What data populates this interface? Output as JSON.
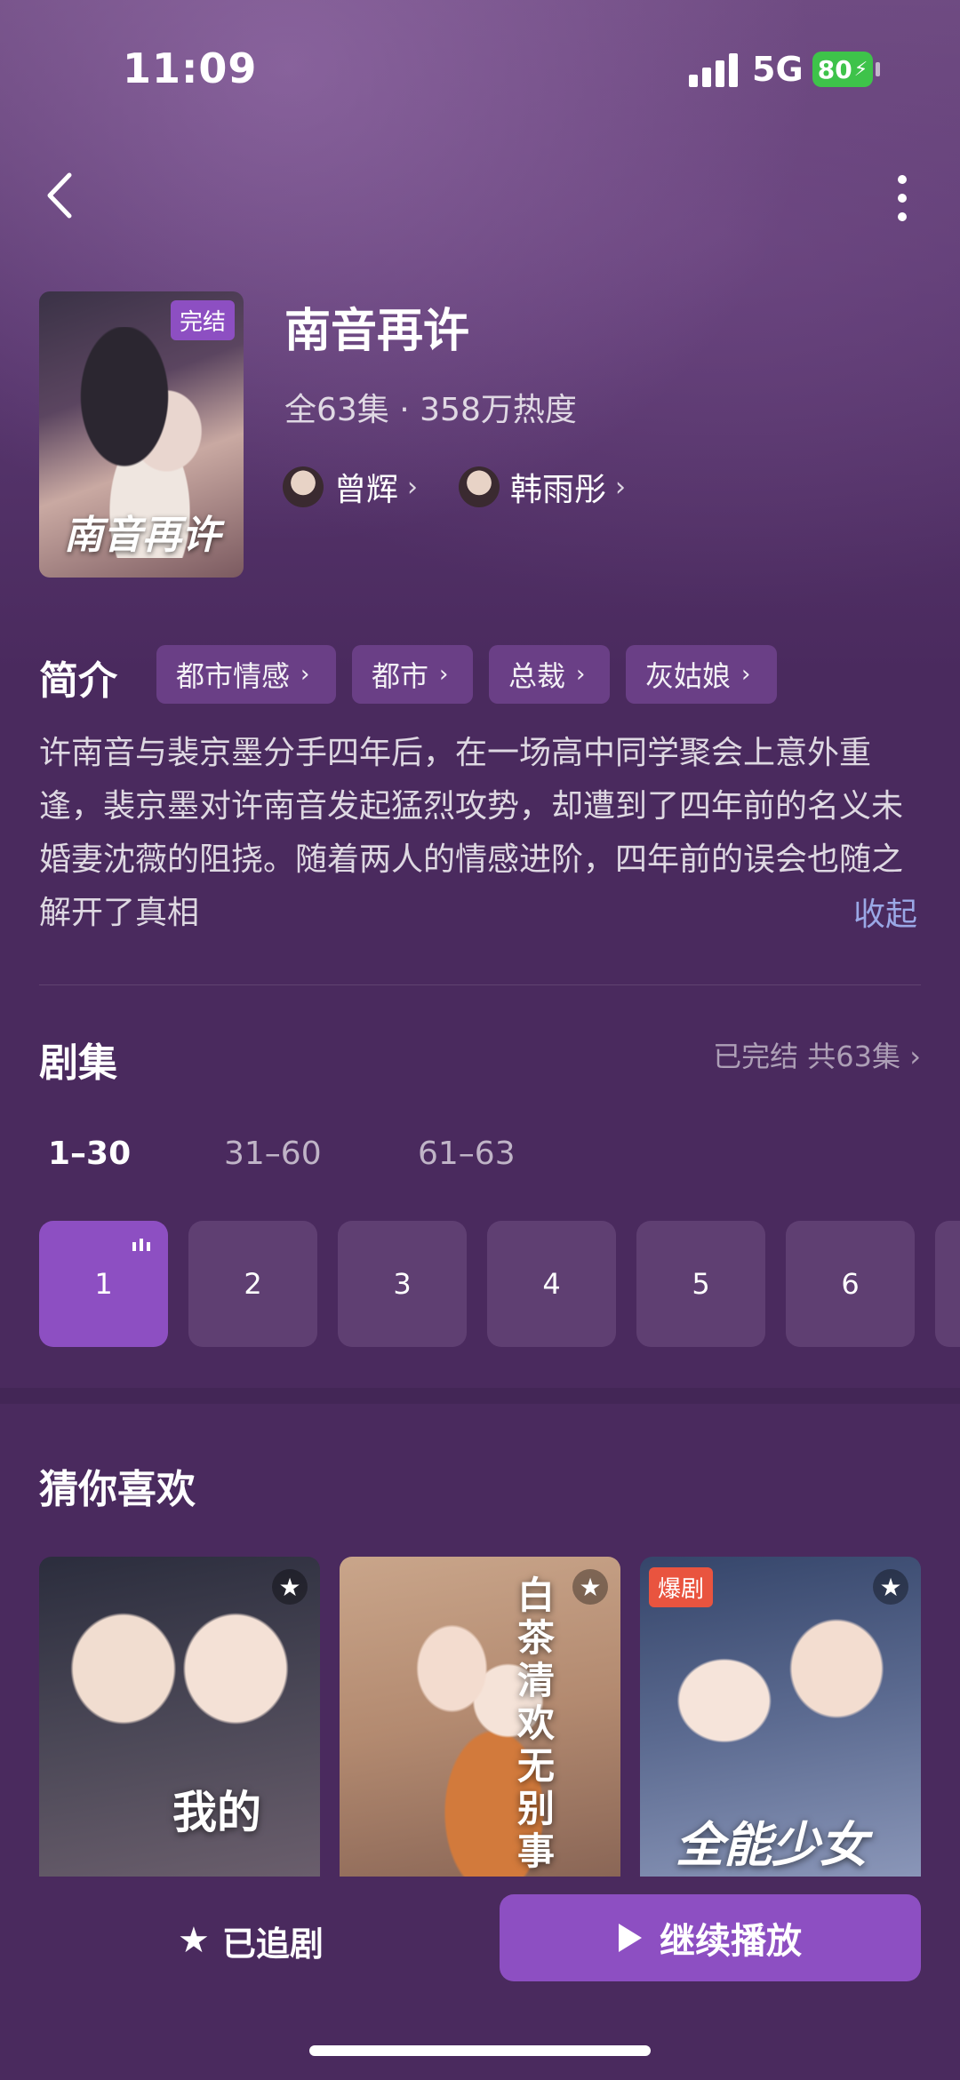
{
  "status_bar": {
    "time": "11:09",
    "network": "5G",
    "battery": "80"
  },
  "drama": {
    "title": "南音再许",
    "badge": "完结",
    "poster_title": "南音再许",
    "meta": "全63集 · 358万热度",
    "actors": [
      {
        "name": "曾辉"
      },
      {
        "name": "韩雨彤"
      }
    ]
  },
  "intro": {
    "label": "简介",
    "tags": [
      "都市情感",
      "都市",
      "总裁",
      "灰姑娘"
    ],
    "description": "许南音与裴京墨分手四年后，在一场高中同学聚会上意外重逢，裴京墨对许南音发起猛烈攻势，却遭到了四年前的名义未婚妻沈薇的阻挠。随着两人的情感进阶，四年前的误会也随之解开了真相",
    "collapse": "收起"
  },
  "episodes": {
    "title": "剧集",
    "status": "已完结 共63集 ›",
    "ranges": [
      "1–30",
      "31–60",
      "61–63"
    ],
    "items": [
      "1",
      "2",
      "3",
      "4",
      "5",
      "6"
    ]
  },
  "recommend": {
    "title": "猜你喜欢",
    "cards": [
      {
        "art_title": "我的",
        "badge": ""
      },
      {
        "art_title": "白茶清欢无别事",
        "badge": ""
      },
      {
        "art_title": "全能少女",
        "badge": "爆剧"
      }
    ]
  },
  "actions": {
    "follow": "已追剧",
    "play": "继续播放"
  },
  "colors": {
    "accent": "#8d4fc2",
    "background": "#4a2a5e",
    "link": "#9aa8e6"
  }
}
